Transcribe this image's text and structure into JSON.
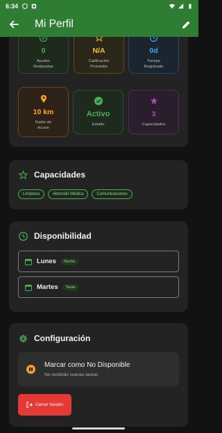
{
  "status_bar": {
    "time": "6:34"
  },
  "app_bar": {
    "title": "Mi Perfil"
  },
  "stats": [
    {
      "value": "0",
      "label_line1": "Ayudes",
      "label_line2": "Realizadas",
      "icon": "check-circle-icon",
      "color": "#4caf50"
    },
    {
      "value": "N/A",
      "label_line1": "Calificación",
      "label_line2": "Promedio",
      "icon": "star-outline-icon",
      "color": "#f2c12e"
    },
    {
      "value": "0d",
      "label_line1": "Tiempo",
      "label_line2": "Registrado",
      "icon": "clock-icon",
      "color": "#42a5f5"
    },
    {
      "value": "10 km",
      "label_line1": "Radio de",
      "label_line2": "Acción",
      "icon": "location-pin-icon",
      "color": "#ffa726"
    },
    {
      "value": "Activo",
      "label_line1": "Estado",
      "label_line2": "",
      "icon": "check-circle-icon",
      "color": "#4caf50"
    },
    {
      "value": "3",
      "label_line1": "Capacidades",
      "label_line2": "",
      "icon": "star-icon",
      "color": "#ab47bc"
    }
  ],
  "capacidades": {
    "title": "Capacidades",
    "chips": [
      "Limpieza",
      "Atención Médica",
      "Comunicaciones"
    ]
  },
  "disponibilidad": {
    "title": "Disponibilidad",
    "rows": [
      {
        "day": "Lunes",
        "shift": "Noche"
      },
      {
        "day": "Martes",
        "shift": "Tarde"
      }
    ]
  },
  "configuracion": {
    "title": "Configuración",
    "toggle_title": "Marcar como No Disponible",
    "toggle_subtitle": "No recibirás nuevas tareas",
    "logout_label": "Cerrar Sesión"
  },
  "colors": {
    "primary": "#2e7d32",
    "accent": "#4caf50",
    "danger": "#e53935"
  }
}
